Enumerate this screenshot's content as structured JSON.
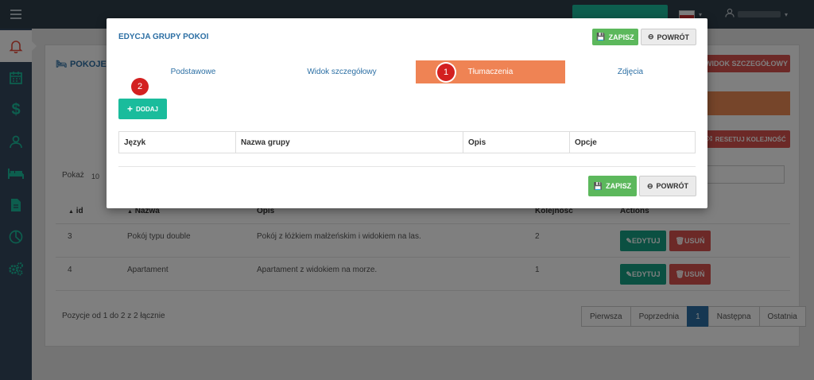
{
  "background": {
    "panel_title": "POKOJE",
    "btn_detail_view": "WIDOK SZCZEGÓŁOWY",
    "btn_reset_order": "RESETUJ KOLEJNOŚĆ",
    "show_label": "Pokaż",
    "show_value": "10",
    "columns": [
      "id",
      "Nazwa",
      "Opis",
      "Kolejność",
      "Actions"
    ],
    "rows": [
      {
        "id": "3",
        "name": "Pokój typu double",
        "desc": "Pokój z łóżkiem małżeńskim i widokiem na las.",
        "order": "2"
      },
      {
        "id": "4",
        "name": "Apartament",
        "desc": "Apartament z widokiem na morze.",
        "order": "1"
      }
    ],
    "edit_label": "EDYTUJ",
    "delete_label": "USUŃ",
    "pagination_info": "Pozycje od 1 do 2 z 2 łącznie",
    "pager": [
      "Pierwsza",
      "Poprzednia",
      "1",
      "Następna",
      "Ostatnia"
    ]
  },
  "modal": {
    "title": "EDYCJA GRUPY POKOI",
    "save_label": "ZAPISZ",
    "back_label": "POWRÓT",
    "tabs": [
      "Podstawowe",
      "Widok szczegółowy",
      "Tłumaczenia",
      "Zdjęcia"
    ],
    "active_tab": "Tłumaczenia",
    "add_label": "DODAJ",
    "table_columns": [
      "Język",
      "Nazwa grupy",
      "Opis",
      "Opcje"
    ],
    "badges": [
      "1",
      "2"
    ]
  },
  "colors": {
    "sidebar": "#34495e",
    "accent_teal": "#1abc9c",
    "active_tab": "#ef8354",
    "badge": "#d32020",
    "save": "#5cb85c"
  }
}
